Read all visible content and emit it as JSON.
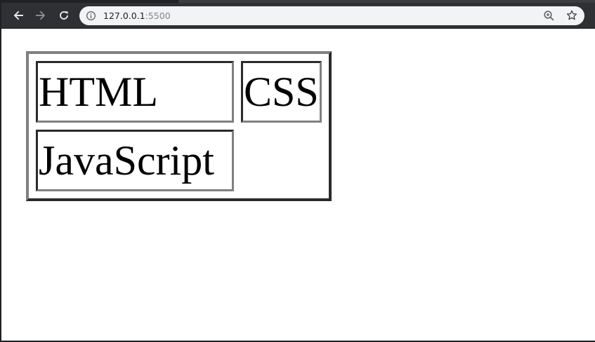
{
  "browser": {
    "url_host": "127.0.0.1",
    "url_port": ":5500",
    "icons": {
      "back": "arrow-left-icon",
      "forward": "arrow-right-icon",
      "reload": "reload-icon",
      "site_info": "info-icon",
      "zoom": "zoom-in-icon",
      "bookmark": "star-icon"
    },
    "colors": {
      "toolbar": "#2f3033",
      "omnibox": "#f1f3f4"
    }
  },
  "table": {
    "rows": [
      [
        "HTML",
        "CSS"
      ],
      [
        "JavaScript",
        ""
      ]
    ],
    "colors": {
      "dark_border": "#2a2a2a",
      "light_border": "#808080"
    }
  }
}
